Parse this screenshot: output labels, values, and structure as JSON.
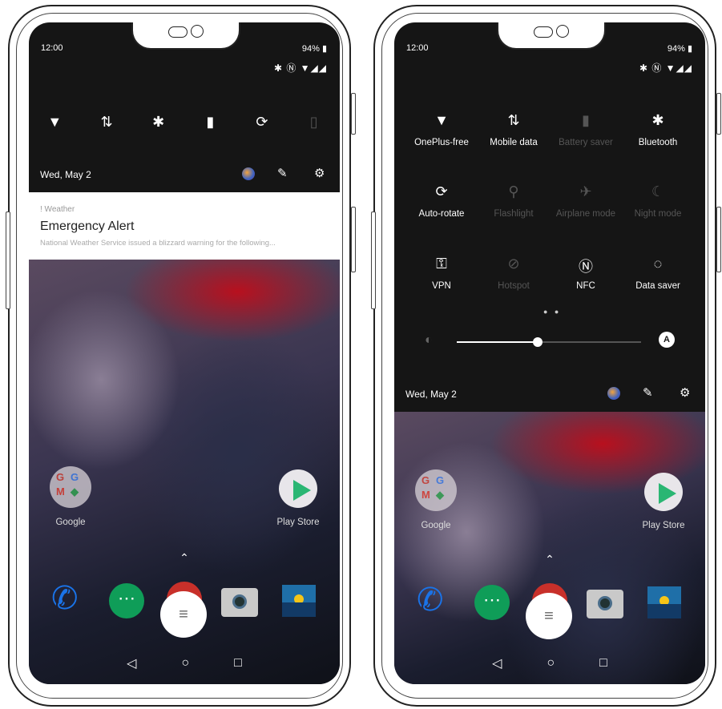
{
  "left_phone": {
    "status": {
      "time": "12:00",
      "battery": "94%",
      "icons": "✱ Ⓝ ▼◢◢"
    },
    "quick_icons": [
      "wifi-icon",
      "mobile-data-icon",
      "bluetooth-icon",
      "flashlight-icon",
      "auto-rotate-icon",
      "battery-saver-icon"
    ],
    "date": "Wed, May 2",
    "notification": {
      "app": "! Weather",
      "title": "Emergency Alert",
      "body": "National Weather Service issued a blizzard warning for the following..."
    },
    "home": {
      "google_label": "Google",
      "play_label": "Play Store"
    }
  },
  "right_phone": {
    "status": {
      "time": "12:00",
      "battery": "94%",
      "icons": "✱ Ⓝ ▼◢◢"
    },
    "tiles": [
      {
        "icon": "▼",
        "label": "OnePlus-free",
        "active": true
      },
      {
        "icon": "⇅",
        "label": "Mobile data",
        "active": true
      },
      {
        "icon": "▮",
        "label": "Battery saver",
        "active": false
      },
      {
        "icon": "✱",
        "label": "Bluetooth",
        "active": true
      },
      {
        "icon": "⟳",
        "label": "Auto-rotate",
        "active": true
      },
      {
        "icon": "⚲",
        "label": "Flashlight",
        "active": false
      },
      {
        "icon": "✈",
        "label": "Airplane mode",
        "active": false
      },
      {
        "icon": "☾",
        "label": "Night mode",
        "active": false
      },
      {
        "icon": "⚿",
        "label": "VPN",
        "active": true
      },
      {
        "icon": "⊘",
        "label": "Hotspot",
        "active": false
      },
      {
        "icon": "Ⓝ",
        "label": "NFC",
        "active": true
      },
      {
        "icon": "◌",
        "label": "Data saver",
        "active": true
      }
    ],
    "brightness_level": 0.44,
    "brightness_auto": "A",
    "date": "Wed, May 2",
    "home": {
      "google_label": "Google",
      "play_label": "Play Store"
    }
  },
  "colors": {
    "panel": "#151515",
    "accent_green": "#0f9d58",
    "dim": "#555555"
  }
}
